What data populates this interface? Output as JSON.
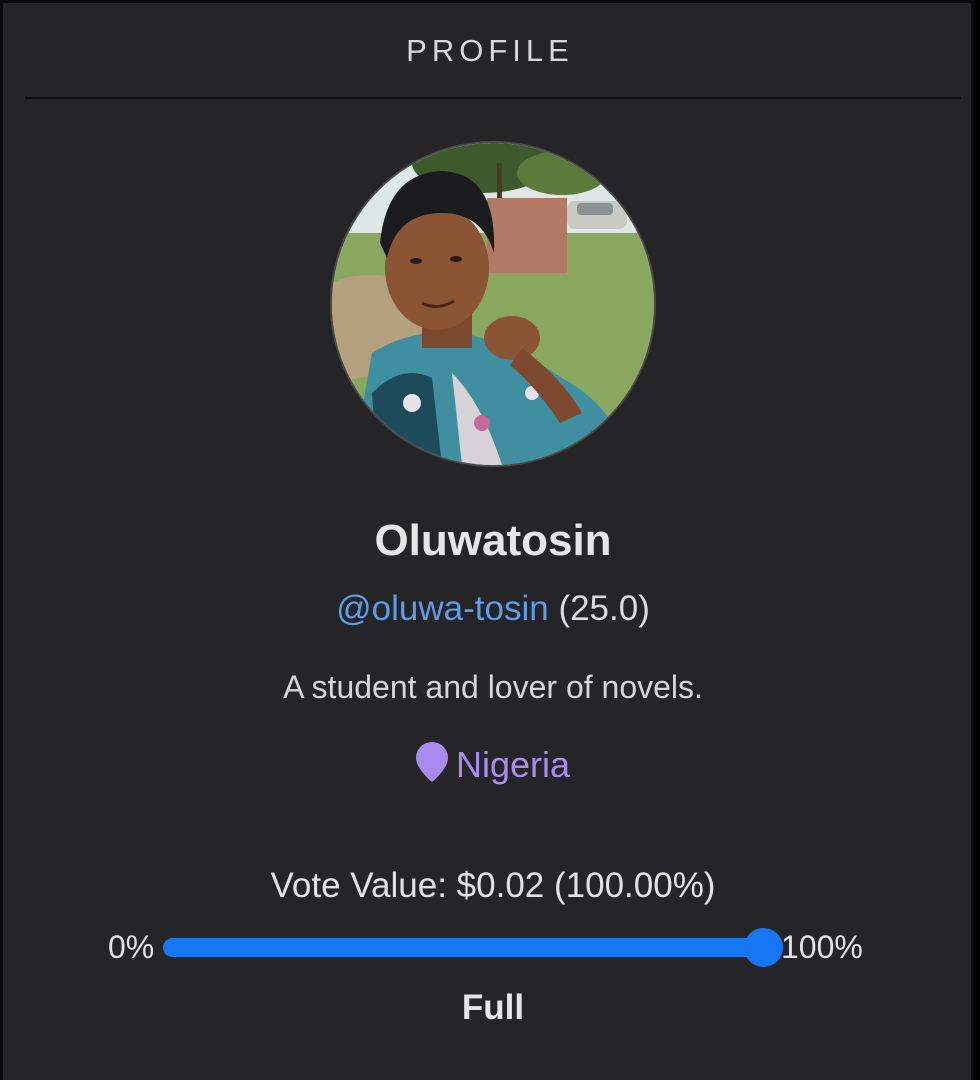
{
  "header": {
    "title": "PROFILE"
  },
  "profile": {
    "name": "Oluwatosin",
    "handle": "@oluwa-tosin",
    "reputation": "(25.0)",
    "bio": "A student and lover of novels.",
    "location": "Nigeria"
  },
  "vote": {
    "label": "Vote Value: $0.02 (100.00%)",
    "slider_min_label": "0%",
    "slider_max_label": "100%",
    "level": 1.0,
    "mode": "Full"
  },
  "icons": {
    "location": "map-pin-icon"
  },
  "colors": {
    "panel_background": "#252527",
    "link": "#5d9ce8",
    "location": "#a98bf0",
    "slider_accent": "#1677f2"
  }
}
